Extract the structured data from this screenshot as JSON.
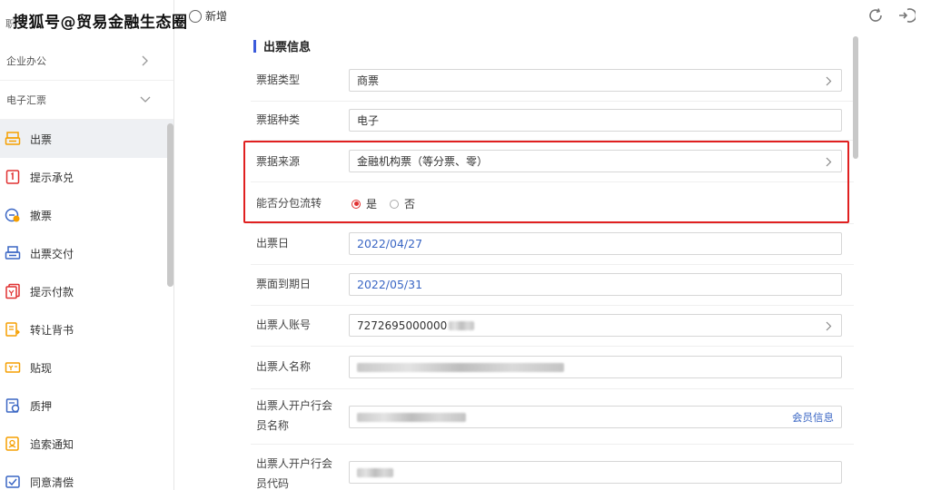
{
  "watermark": "搜狐号@贸易金融生态圈",
  "topbar": {
    "tab_label": "新增"
  },
  "sidebar": {
    "cut_label": "职",
    "groups": [
      {
        "label": "企业办公"
      },
      {
        "label": "电子汇票"
      }
    ],
    "items": [
      {
        "label": "出票",
        "icon": "bill-issue-icon"
      },
      {
        "label": "提示承兑",
        "icon": "accept-icon"
      },
      {
        "label": "撤票",
        "icon": "revoke-icon"
      },
      {
        "label": "出票交付",
        "icon": "deliver-icon"
      },
      {
        "label": "提示付款",
        "icon": "payment-icon"
      },
      {
        "label": "转让背书",
        "icon": "endorse-icon"
      },
      {
        "label": "贴现",
        "icon": "discount-icon"
      },
      {
        "label": "质押",
        "icon": "pledge-icon"
      },
      {
        "label": "追索通知",
        "icon": "recourse-icon"
      },
      {
        "label": "同意清偿",
        "icon": "settle-icon"
      }
    ]
  },
  "form": {
    "section_title": "出票信息",
    "bill_type": {
      "label": "票据类型",
      "value": "商票"
    },
    "bill_kind": {
      "label": "票据种类",
      "value": "电子"
    },
    "bill_source": {
      "label": "票据来源",
      "value": "金融机构票（等分票、零）"
    },
    "splittable": {
      "label": "能否分包流转",
      "options": [
        "是",
        "否"
      ],
      "selected": "是"
    },
    "issue_date": {
      "label": "出票日",
      "value": "2022/04/27"
    },
    "due_date": {
      "label": "票面到期日",
      "value": "2022/05/31"
    },
    "drawer_account": {
      "label": "出票人账号",
      "value": "7272695000000"
    },
    "drawer_name": {
      "label": "出票人名称"
    },
    "drawer_bank_name": {
      "label_line1": "出票人开户行会",
      "label_line2": "员名称",
      "link": "会员信息"
    },
    "drawer_bank_code": {
      "label_line1": "出票人开户行会",
      "label_line2": "员代码"
    }
  },
  "colors": {
    "accent": "#3b5bdb",
    "highlight": "#e02020",
    "link": "#3a66c4"
  }
}
